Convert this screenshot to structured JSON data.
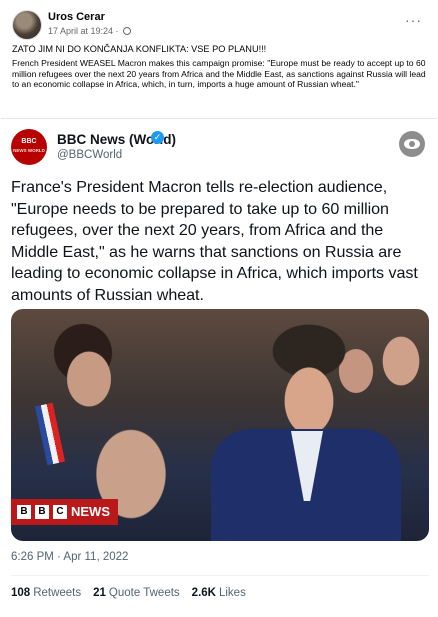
{
  "facebook_post": {
    "author": "Uros Cerar",
    "timestamp": "17 April at 19:24 ·",
    "more_label": "···",
    "headline": "ZATO JIM NI DO KONČANJA KONFLIKTA: VSE PO PLANU!!!",
    "body": "French President WEASEL Macron makes this campaign promise: \"Europe must be ready to accept up to 60 million refugees over the next 20 years from Africa and the Middle East, as sanctions against Russia will lead to an economic collapse in Africa, which, in turn, imports a huge amount of Russian  wheat.\""
  },
  "tweet": {
    "logo_text": "BBC",
    "logo_sub": "NEWS WORLD",
    "author_name": "BBC News (World)",
    "verified_glyph": "✓",
    "handle": "@BBCWorld",
    "text": "France's President Macron tells re-election audience, \"Europe needs to be prepared to take up to 60 million refugees, over the next 20 years, from Africa and the Middle East,\" as he warns that sanctions on Russia are leading to economic collapse in Africa, which imports vast amounts of Russian wheat.",
    "photo_badge": {
      "block1": "B",
      "block2": "B",
      "block3": "C",
      "label": "NEWS"
    },
    "time": "6:26 PM · Apr 11, 2022",
    "stats": {
      "retweets_count": "108",
      "retweets_label": "Retweets",
      "quotes_count": "21",
      "quotes_label": "Quote Tweets",
      "likes_count": "2.6K",
      "likes_label": "Likes"
    }
  },
  "colors": {
    "bbc_red": "#bb1919",
    "verified_blue": "#1d9bf0",
    "suit_navy": "#1f2f6a"
  },
  "icons": [
    "globe-icon",
    "more-options-icon",
    "verified-badge-icon",
    "hide-eye-icon"
  ]
}
